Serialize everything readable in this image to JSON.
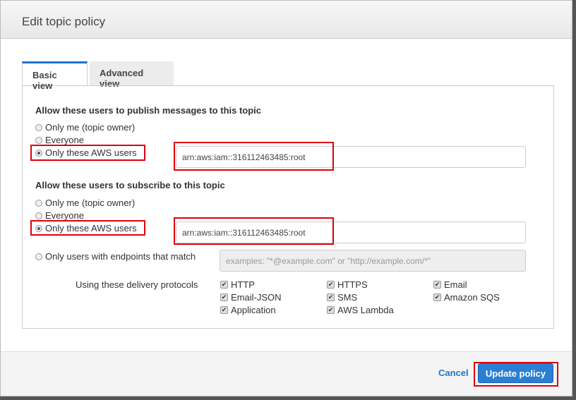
{
  "title": "Edit topic policy",
  "tabs": [
    "Basic view",
    "Advanced view"
  ],
  "publish": {
    "heading": "Allow these users to publish messages to this topic",
    "options": [
      "Only me (topic owner)",
      "Everyone",
      "Only these AWS users"
    ],
    "selected": 2,
    "value": "arn:aws:iam::316112463485:root"
  },
  "subscribe": {
    "heading": "Allow these users to subscribe to this topic",
    "options": [
      "Only me (topic owner)",
      "Everyone",
      "Only these AWS users",
      "Only users with endpoints that match"
    ],
    "selected": 2,
    "value": "arn:aws:iam::316112463485:root",
    "endpoint_placeholder": "examples: \"*@example.com\" or \"http://example.com/*\""
  },
  "protocols": {
    "label": "Using these delivery protocols",
    "items": [
      "HTTP",
      "HTTPS",
      "Email",
      "Email-JSON",
      "SMS",
      "Amazon SQS",
      "Application",
      "AWS Lambda"
    ],
    "checked": [
      true,
      true,
      true,
      true,
      true,
      true,
      true,
      true
    ]
  },
  "footer": {
    "cancel": "Cancel",
    "update": "Update policy"
  },
  "colors": {
    "accent": "#1f75c7",
    "highlight": "#e0000b"
  }
}
